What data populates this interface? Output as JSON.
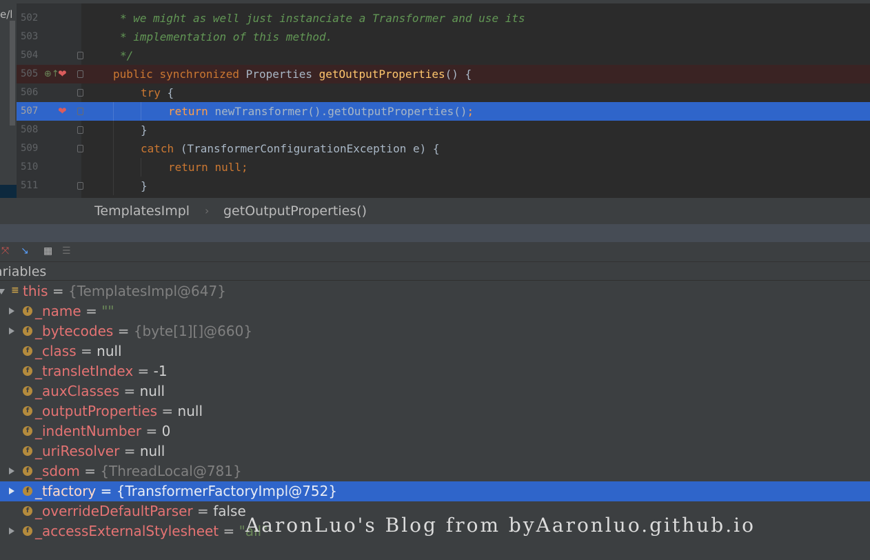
{
  "editor": {
    "left_strip_text": "e/l",
    "lines": [
      {
        "num": "502",
        "text": "* we might as well just instanciate a Transformer and use its"
      },
      {
        "num": "503",
        "text": "* implementation of this method."
      },
      {
        "num": "504",
        "text": "*/"
      },
      {
        "num": "505",
        "t1": "public",
        "t2": "synchronized",
        "t3": "Properties",
        "t4": "getOutputProperties",
        "t5": "() {"
      },
      {
        "num": "506",
        "t1": "try",
        "t2": "{"
      },
      {
        "num": "507",
        "t1": "return",
        "t2": "newTransformer().getOutputProperties()",
        "t3": ";"
      },
      {
        "num": "508",
        "t1": "}"
      },
      {
        "num": "509",
        "t1": "catch",
        "t2": "(TransformerConfigurationException e) {"
      },
      {
        "num": "510",
        "t1": "return",
        "t2": "null",
        "t3": ";"
      },
      {
        "num": "511",
        "t1": "}"
      }
    ]
  },
  "breadcrumb": {
    "class": "TemplatesImpl",
    "separator": "›",
    "method": "getOutputProperties()"
  },
  "toolbar": {
    "icons": [
      "restore-layout-icon",
      "step-into-icon",
      "table-view-icon",
      "settings-icon"
    ]
  },
  "variables": {
    "header": "ariables",
    "root": {
      "name": "this",
      "eq": " = ",
      "value": "{TemplatesImpl@647}"
    },
    "fields": [
      {
        "name": "_name",
        "eq": " = ",
        "value": "\"\"",
        "kind": "str",
        "expand": true
      },
      {
        "name": "_bytecodes",
        "eq": " = ",
        "value": "{byte[1][]@660}",
        "kind": "obj",
        "expand": true
      },
      {
        "name": "_class",
        "eq": " = ",
        "value": "null",
        "kind": "plain",
        "expand": false
      },
      {
        "name": "_transletIndex",
        "eq": " = ",
        "value": "-1",
        "kind": "plain",
        "expand": false
      },
      {
        "name": "_auxClasses",
        "eq": " = ",
        "value": "null",
        "kind": "plain",
        "expand": false
      },
      {
        "name": "_outputProperties",
        "eq": " = ",
        "value": "null",
        "kind": "plain",
        "expand": false
      },
      {
        "name": "_indentNumber",
        "eq": " = ",
        "value": "0",
        "kind": "plain",
        "expand": false
      },
      {
        "name": "_uriResolver",
        "eq": " = ",
        "value": "null",
        "kind": "plain",
        "expand": false
      },
      {
        "name": "_sdom",
        "eq": " = ",
        "value": "{ThreadLocal@781}",
        "kind": "obj",
        "expand": true
      },
      {
        "name": "_tfactory",
        "eq": " = ",
        "value": "{TransformerFactoryImpl@752}",
        "kind": "obj",
        "expand": true,
        "selected": true
      },
      {
        "name": "_overrideDefaultParser",
        "eq": " = ",
        "value": "false",
        "kind": "plain",
        "expand": false
      },
      {
        "name": "_accessExternalStylesheet",
        "eq": " = ",
        "value": "\"all\"",
        "kind": "str",
        "expand": true
      }
    ]
  },
  "field_icon_letter": "f",
  "watermark": "AaronLuo's Blog from byAaronluo.github.io",
  "colors": {
    "editor_bg": "#2b2b2b",
    "keyword": "#cc7832",
    "method": "#ffc66d",
    "comment": "#629755",
    "selection": "#2f65ca",
    "var_name": "#e57373"
  }
}
